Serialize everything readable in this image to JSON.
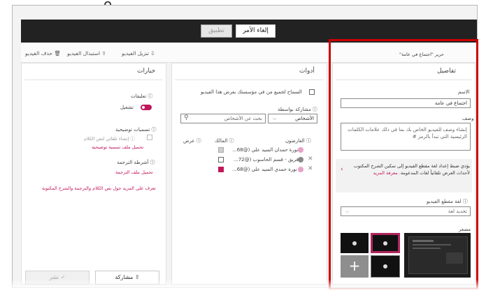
{
  "header": {
    "partial_letter": "o",
    "cancel_label": "إلغاء الأمر",
    "apply_label": "تطبيق"
  },
  "toolbar": {
    "download": "تنزيل الفيديو",
    "replace": "استبدال الفيديو",
    "delete": "حذف الفيديو"
  },
  "details": {
    "breadcrumb": "حرير \"اجتماع في عامة\"",
    "title": "تفاصيل",
    "name_label": "الاسم",
    "name_value": "اجتماع في عامة",
    "desc_label": "وصف",
    "desc_value": "إنشاء وصف للفيديو الخاص بك بما في ذلك علامات الكلمات الرئيسية التي تبدأ بالرمز #",
    "lang_notice": "يؤدي ضبط إعداد لغة مقطع الفيديو إلى تمكين الشرح المكتوب لأحداث العرض تلقائياً لغات المدعومة.",
    "lang_notice_link": "معرفة المزيد",
    "lang_label": "لغة مقطع الفيديو",
    "lang_value": "تحديد لغة",
    "thumb_label": "مصغر"
  },
  "tools": {
    "title": "أدوات",
    "allow_viewers": "السماح لجميع من في مؤسستك بعرض هذا الفيديو",
    "share_label": "مشاركة بواسطة",
    "share_select": "الأشخاص",
    "search_placeholder": "بحث عن الأشخاص",
    "col_viewers": "العارضون",
    "col_owner": "المالك",
    "col_view": "عرض",
    "people": [
      {
        "name": "نورة حمدان السيد علي (@68...",
        "checked": false
      },
      {
        "name": "فريق - قسم الحاسوب (@72...",
        "checked": false
      },
      {
        "name": "نورة حمدي السيد علي (@68...",
        "checked": true
      }
    ]
  },
  "options": {
    "title": "خيارات",
    "comments_label": "تعليقات",
    "comments_state": "تشغيل",
    "captions_label": "تسميات توضيحية",
    "auto_captions": "إنشاء تلقائي لنص الكلام",
    "upload_captions": "تحميل ملف تسمية توضيحية",
    "tracks_label": "أشرطة الترجمة",
    "upload_tracks": "تحميل ملف الترجمة",
    "learn_more": "تعرف على المزيد حول نص الكلام والترجمة والشرح المكتوبة",
    "share_btn": "مشاركة",
    "publish_btn": "نشر"
  },
  "colors": {
    "accent": "#c2185b",
    "highlight": "#cc0000",
    "dark_bar": "#222222"
  }
}
